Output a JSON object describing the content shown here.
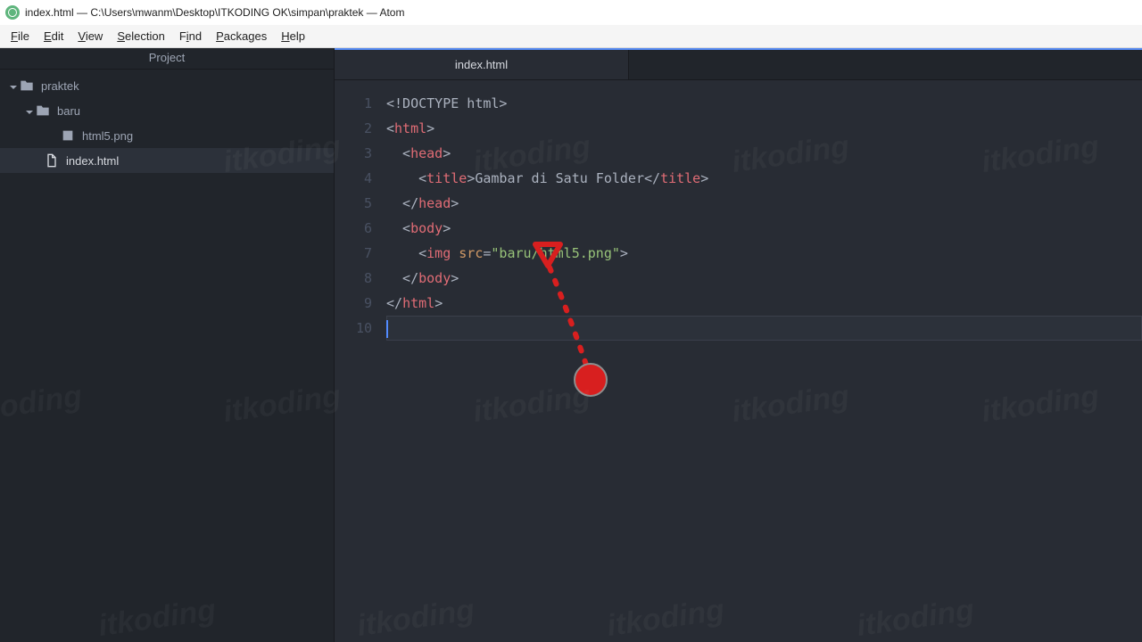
{
  "window_title": "index.html — C:\\Users\\mwanm\\Desktop\\ITKODING OK\\simpan\\praktek — Atom",
  "menu": [
    "File",
    "Edit",
    "View",
    "Selection",
    "Find",
    "Packages",
    "Help"
  ],
  "sidebar_title": "Project",
  "tree": {
    "root": "praktek",
    "folder": "baru",
    "file_png": "html5.png",
    "file_html": "index.html"
  },
  "tab": "index.html",
  "editor": {
    "lines": [
      "1",
      "2",
      "3",
      "4",
      "5",
      "6",
      "7",
      "8",
      "9",
      "10"
    ],
    "doctype": "<!DOCTYPE html>",
    "html_open": "html",
    "head_open": "head",
    "title_open": "title",
    "title_text": "Gambar di Satu Folder",
    "title_close": "title",
    "head_close": "head",
    "body_open": "body",
    "img_tag": "img",
    "img_attr": "src",
    "img_val": "\"baru/html5.png\"",
    "body_close": "body",
    "html_close": "html"
  },
  "watermark": "itkoding"
}
